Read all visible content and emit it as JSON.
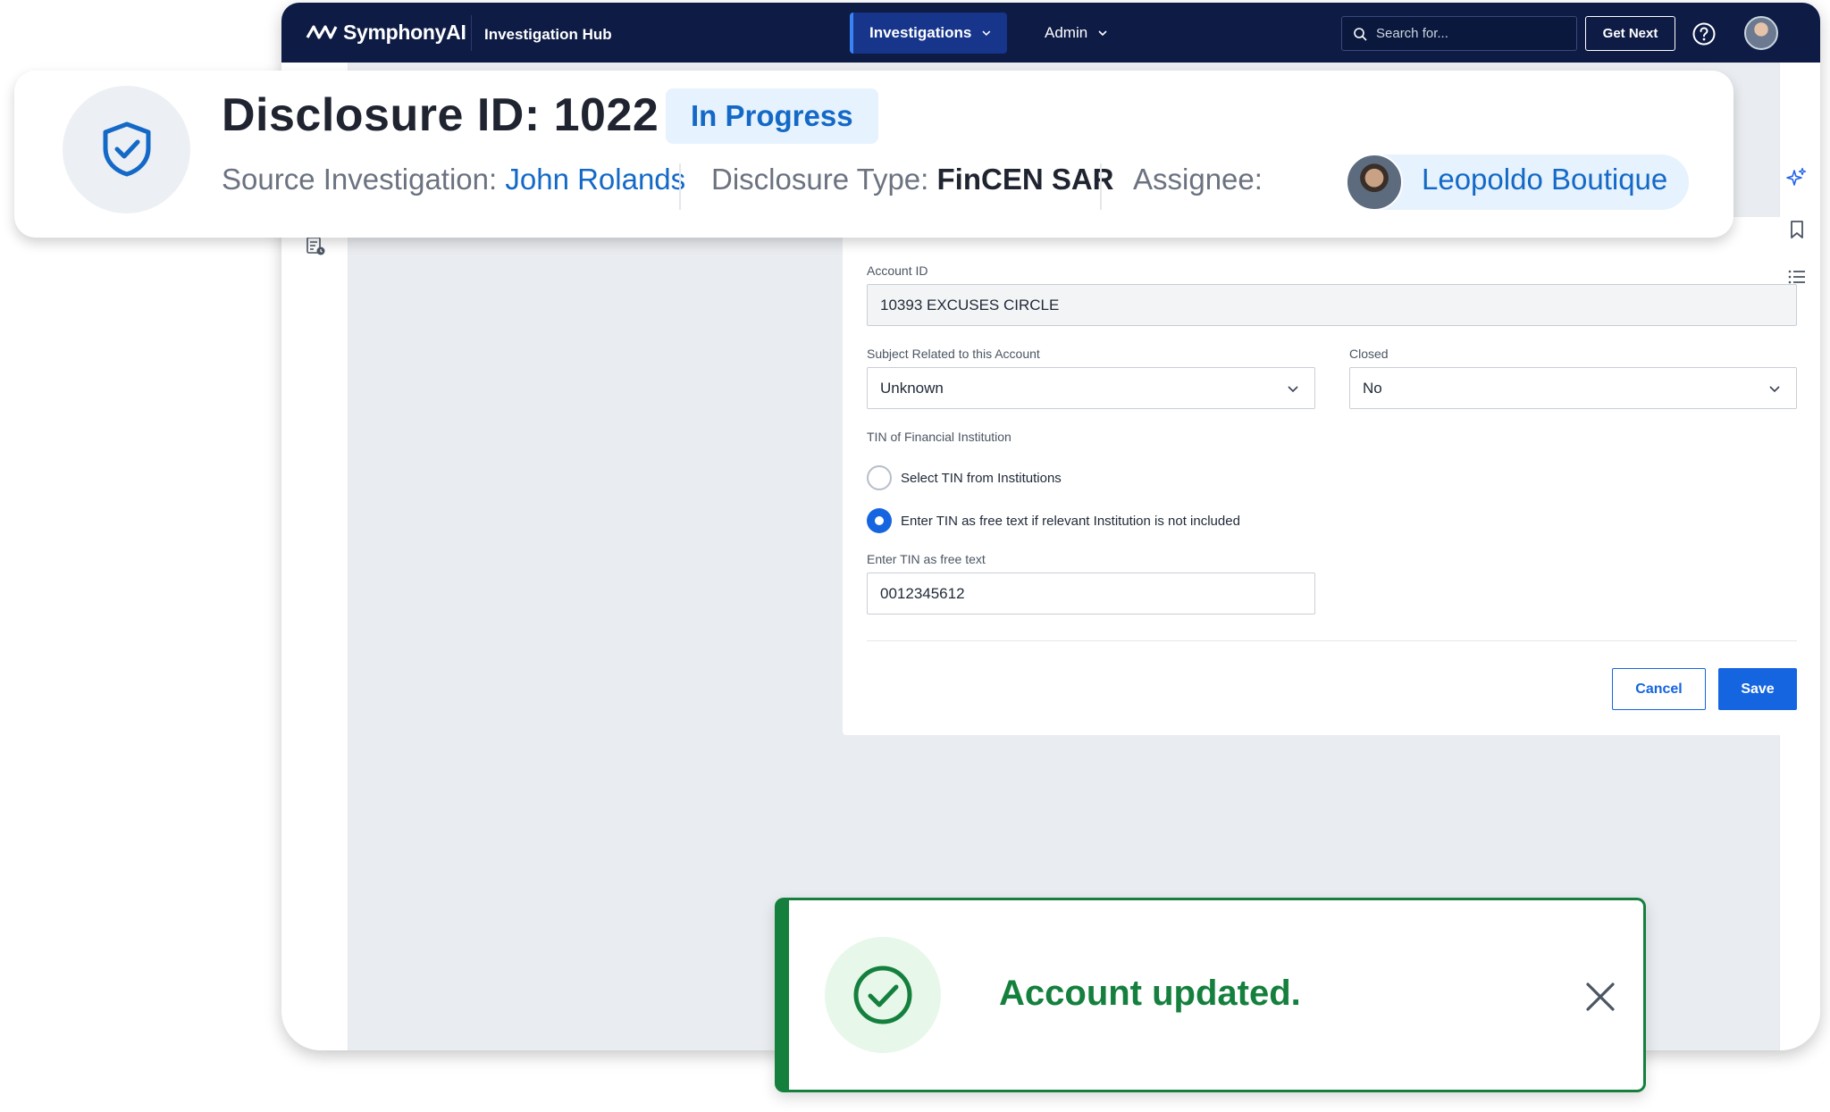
{
  "app": {
    "brand": "SymphonyAI",
    "product": "Investigation Hub"
  },
  "nav": {
    "investigations_label": "Investigations",
    "admin_label": "Admin"
  },
  "search": {
    "placeholder": "Search for..."
  },
  "actions": {
    "get_next_label": "Get Next"
  },
  "header": {
    "title": "Disclosure ID: 1022",
    "status": "In Progress",
    "source_label": "Source Investigation:",
    "source_value": "John Rolands",
    "type_label": "Disclosure Type:",
    "type_value": "FinCEN SAR",
    "assignee_label": "Assignee:",
    "assignee_value": "Leopoldo Boutique"
  },
  "form": {
    "account_id_label": "Account ID",
    "account_id_value": "10393 EXCUSES CIRCLE",
    "subject_label": "Subject Related to this Account",
    "subject_value": "Unknown",
    "closed_label": "Closed",
    "closed_value": "No",
    "tin_label": "TIN of Financial Institution",
    "tin_option_select": "Select TIN from Institutions",
    "tin_option_free": "Enter TIN as free text if relevant Institution is not included",
    "tin_free_label": "Enter TIN as free text",
    "tin_free_value": "0012345612",
    "cancel_label": "Cancel",
    "save_label": "Save"
  },
  "toast": {
    "message": "Account updated."
  },
  "colors": {
    "navy": "#0d1b45",
    "primary": "#1565e0",
    "link": "#1469c7",
    "success": "#15803d"
  }
}
